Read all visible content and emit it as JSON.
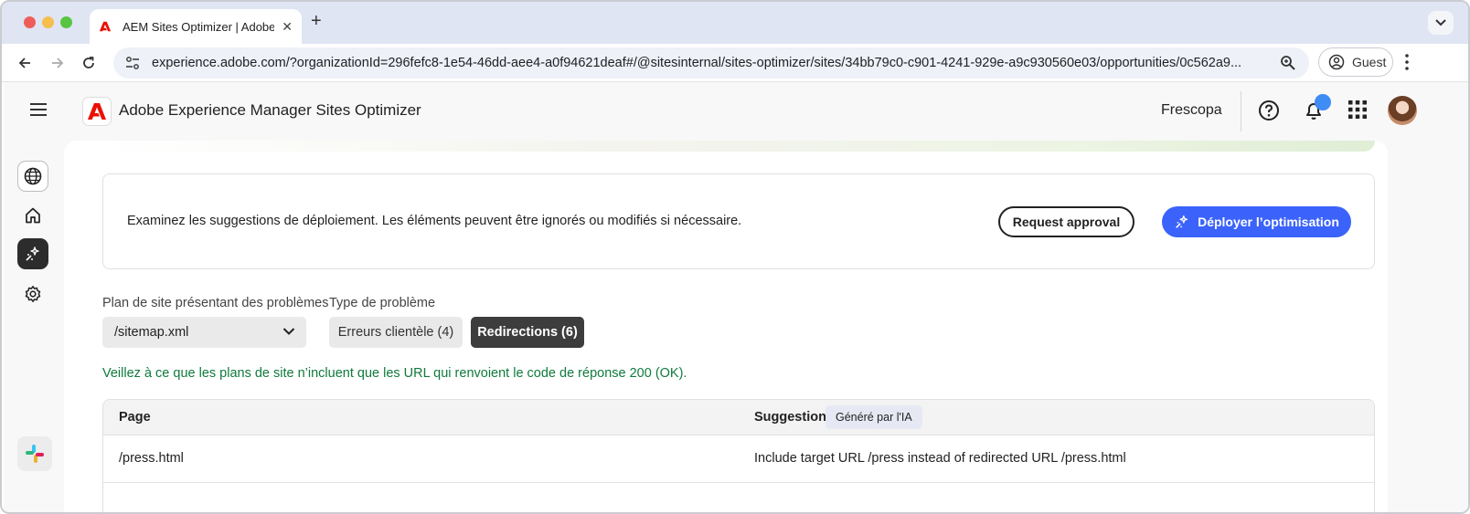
{
  "browser": {
    "tab_title": "AEM Sites Optimizer | Adobe",
    "url": "experience.adobe.com/?organizationId=296fefc8-1e54-46dd-aee4-a0f94621deaf#/@sitesinternal/sites-optimizer/sites/34bb79c0-c901-4241-929e-a9c930560e03/opportunities/0c562a9...",
    "profile_label": "Guest"
  },
  "header": {
    "app_title": "Adobe Experience Manager Sites Optimizer",
    "org_name": "Frescopa"
  },
  "deploy": {
    "text": "Examinez les suggestions de déploiement. Les éléments peuvent être ignorés ou modifiés si nécessaire.",
    "approval_label": "Request approval",
    "deploy_label": "Déployer l’optimisation"
  },
  "filters": {
    "sitemap_label": "Plan de site présentant des problèmes",
    "sitemap_value": "/sitemap.xml",
    "type_label": "Type de problème",
    "segments": [
      {
        "label": "Erreurs clientèle (4)",
        "selected": false
      },
      {
        "label": "Redirections (6)",
        "selected": true
      }
    ]
  },
  "hint": "Veillez à ce que les plans de site n’incluent que les URL qui renvoient le code de réponse 200 (OK).",
  "table": {
    "columns": [
      "Page",
      "Suggestion"
    ],
    "ai_badge": "Généré par l'IA",
    "rows": [
      {
        "page": "/press.html",
        "suggestion": "Include target URL /press instead of redirected URL /press.html"
      }
    ]
  },
  "colors": {
    "primary_button": "#3b63fb",
    "hint_text": "#0f7a3c",
    "selected_segment": "#3d3d3d",
    "adobe_red": "#eb1000"
  }
}
